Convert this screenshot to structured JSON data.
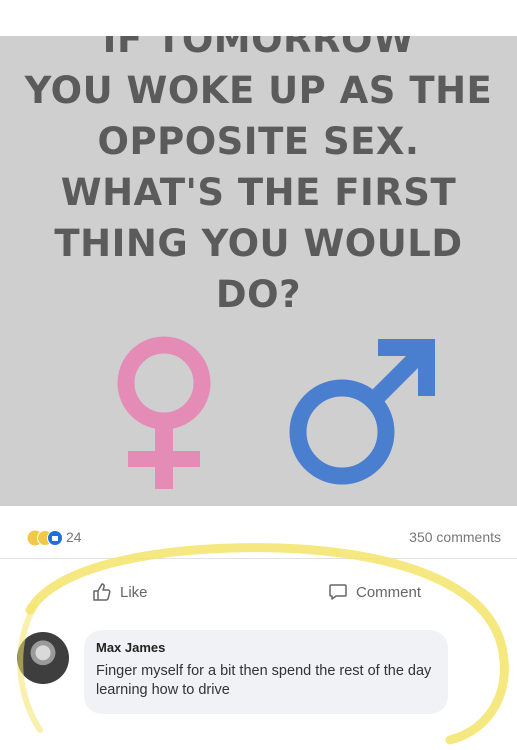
{
  "post": {
    "headline_lines": [
      "IF TOMORROW",
      "YOU WOKE UP AS THE",
      "OPPOSITE SEX.",
      "WHAT'S THE FIRST",
      "THING YOU WOULD",
      "DO?"
    ],
    "colors": {
      "female_symbol": "#e48bb6",
      "male_symbol": "#4a7fd0",
      "text": "#5b5b5b",
      "background": "#cfcfcf"
    }
  },
  "stats": {
    "reaction_count": "24",
    "comments_label": "350 comments"
  },
  "actions": {
    "like_label": "Like",
    "comment_label": "Comment"
  },
  "comment": {
    "author": "Max James",
    "text": "Finger myself for a bit then spend the rest of the day learning how to drive"
  },
  "icons": [
    "laugh-reaction-icon",
    "sad-reaction-icon",
    "like-reaction-icon",
    "thumbs-up-icon",
    "comment-icon",
    "female-symbol-icon",
    "male-symbol-icon"
  ]
}
